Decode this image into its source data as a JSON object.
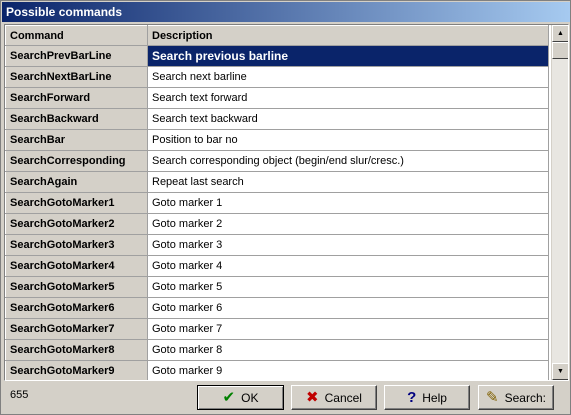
{
  "window": {
    "title": "Possible commands"
  },
  "table": {
    "headers": {
      "command": "Command",
      "description": "Description"
    },
    "rows": [
      {
        "command": "SearchPrevBarLine",
        "description": "Search previous barline",
        "selected": true
      },
      {
        "command": "SearchNextBarLine",
        "description": "Search next barline"
      },
      {
        "command": "SearchForward",
        "description": "Search text forward"
      },
      {
        "command": "SearchBackward",
        "description": "Search text backward"
      },
      {
        "command": "SearchBar",
        "description": "Position to bar no"
      },
      {
        "command": "SearchCorresponding",
        "description": "Search corresponding object (begin/end slur/cresc.)"
      },
      {
        "command": "SearchAgain",
        "description": "Repeat last search"
      },
      {
        "command": "SearchGotoMarker1",
        "description": "Goto marker 1"
      },
      {
        "command": "SearchGotoMarker2",
        "description": "Goto marker 2"
      },
      {
        "command": "SearchGotoMarker3",
        "description": "Goto marker 3"
      },
      {
        "command": "SearchGotoMarker4",
        "description": "Goto marker 4"
      },
      {
        "command": "SearchGotoMarker5",
        "description": "Goto marker 5"
      },
      {
        "command": "SearchGotoMarker6",
        "description": "Goto marker 6"
      },
      {
        "command": "SearchGotoMarker7",
        "description": "Goto marker 7"
      },
      {
        "command": "SearchGotoMarker8",
        "description": "Goto marker 8"
      },
      {
        "command": "SearchGotoMarker9",
        "description": "Goto marker 9"
      }
    ]
  },
  "footer": {
    "count": "655",
    "buttons": {
      "ok": {
        "label": "OK",
        "icon": "checkmark-icon",
        "color": "#008000"
      },
      "cancel": {
        "label": "Cancel",
        "icon": "x-icon",
        "color": "#c00000"
      },
      "help": {
        "label": "Help",
        "icon": "question-icon",
        "color": "#000080"
      },
      "search": {
        "label": "Search:",
        "icon": "flashlight-icon"
      }
    }
  },
  "colors": {
    "titlebar": "#0a246a",
    "selection": "#0a246a",
    "face": "#d4d0c8"
  }
}
